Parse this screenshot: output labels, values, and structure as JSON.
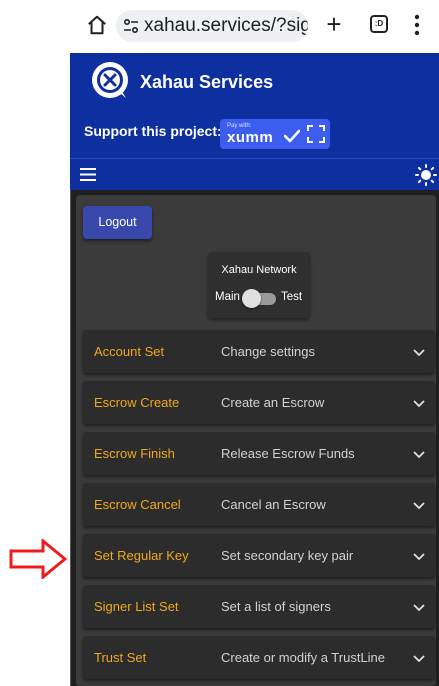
{
  "browser": {
    "url": "xahau.services/?sig",
    "icons": [
      "home-icon",
      "site-settings-icon",
      "new-tab-icon",
      "tab-switcher-icon",
      "more-menu-icon"
    ],
    "tab_switcher_label": ":D"
  },
  "header": {
    "title": "Xahau Services",
    "support_label": "Support this project:",
    "xumm_button": {
      "small_label": "Pay with:",
      "brand": "xumm"
    }
  },
  "toolbar": {
    "icons": [
      "hamburger-menu-icon",
      "sun-icon"
    ]
  },
  "main": {
    "logout_label": "Logout",
    "network": {
      "title": "Xahau Network",
      "left_label": "Main",
      "right_label": "Test",
      "selected": "Main"
    },
    "accordion": [
      {
        "title": "Account Set",
        "description": "Change settings"
      },
      {
        "title": "Escrow Create",
        "description": "Create an Escrow"
      },
      {
        "title": "Escrow Finish",
        "description": "Release Escrow Funds"
      },
      {
        "title": "Escrow Cancel",
        "description": "Cancel an Escrow"
      },
      {
        "title": "Set Regular Key",
        "description": "Set secondary key pair"
      },
      {
        "title": "Signer List Set",
        "description": "Set a list of signers"
      },
      {
        "title": "Trust Set",
        "description": "Create or modify a TrustLine"
      }
    ]
  },
  "colors": {
    "header_blue": "#0d2fa0",
    "accent_orange": "#f0a820",
    "logout_blue": "#3949ab",
    "annotation_red": "#ee1c1c"
  }
}
